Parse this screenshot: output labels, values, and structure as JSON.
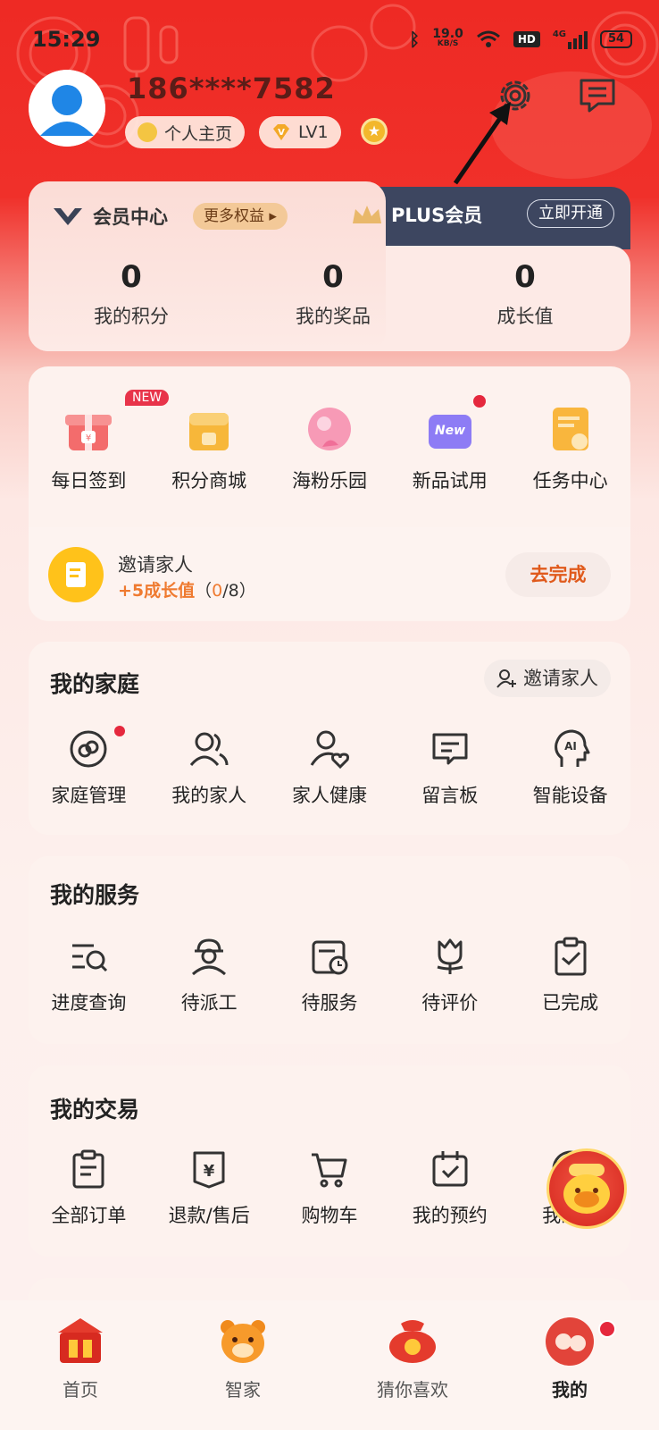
{
  "status_bar": {
    "time": "15:29",
    "speed_value": "19.0",
    "speed_unit": "KB/S",
    "network": "4G",
    "hd": "HD",
    "battery": "54"
  },
  "profile": {
    "phone": "186****7582",
    "homepage_label": "个人主页",
    "level_label": "LV1"
  },
  "member": {
    "center_label": "会员中心",
    "more_rights_label": "更多权益",
    "plus_label": "PLUS会员",
    "open_now_label": "立即开通",
    "stats": [
      {
        "value": "0",
        "label": "我的积分"
      },
      {
        "value": "0",
        "label": "我的奖品"
      },
      {
        "value": "0",
        "label": "成长值"
      }
    ]
  },
  "features": {
    "new_badge": "NEW",
    "new_icon_text": "New",
    "items": [
      {
        "label": "每日签到"
      },
      {
        "label": "积分商城"
      },
      {
        "label": "海粉乐园"
      },
      {
        "label": "新品试用"
      },
      {
        "label": "任务中心"
      }
    ],
    "invite_title": "邀请家人",
    "invite_reward": "+5成长值",
    "invite_progress_open": "（",
    "invite_progress_done": "0",
    "invite_progress_rest": "/8）",
    "go_complete_label": "去完成"
  },
  "family": {
    "title": "我的家庭",
    "invite_button": "邀请家人",
    "items": [
      {
        "label": "家庭管理"
      },
      {
        "label": "我的家人"
      },
      {
        "label": "家人健康"
      },
      {
        "label": "留言板"
      },
      {
        "label": "智能设备"
      }
    ]
  },
  "services": {
    "title": "我的服务",
    "items": [
      {
        "label": "进度查询"
      },
      {
        "label": "待派工"
      },
      {
        "label": "待服务"
      },
      {
        "label": "待评价"
      },
      {
        "label": "已完成"
      }
    ]
  },
  "trades": {
    "title": "我的交易",
    "items": [
      {
        "label": "全部订单"
      },
      {
        "label": "退款/售后"
      },
      {
        "label": "购物车"
      },
      {
        "label": "我的预约"
      },
      {
        "label": "我的收"
      }
    ]
  },
  "tabbar": {
    "items": [
      {
        "label": "首页"
      },
      {
        "label": "智家"
      },
      {
        "label": "猜你喜欢"
      },
      {
        "label": "我的"
      }
    ]
  },
  "colors": {
    "primary_red": "#ee2a24",
    "plus_dark": "#3d4660",
    "orange": "#ef7a30"
  }
}
